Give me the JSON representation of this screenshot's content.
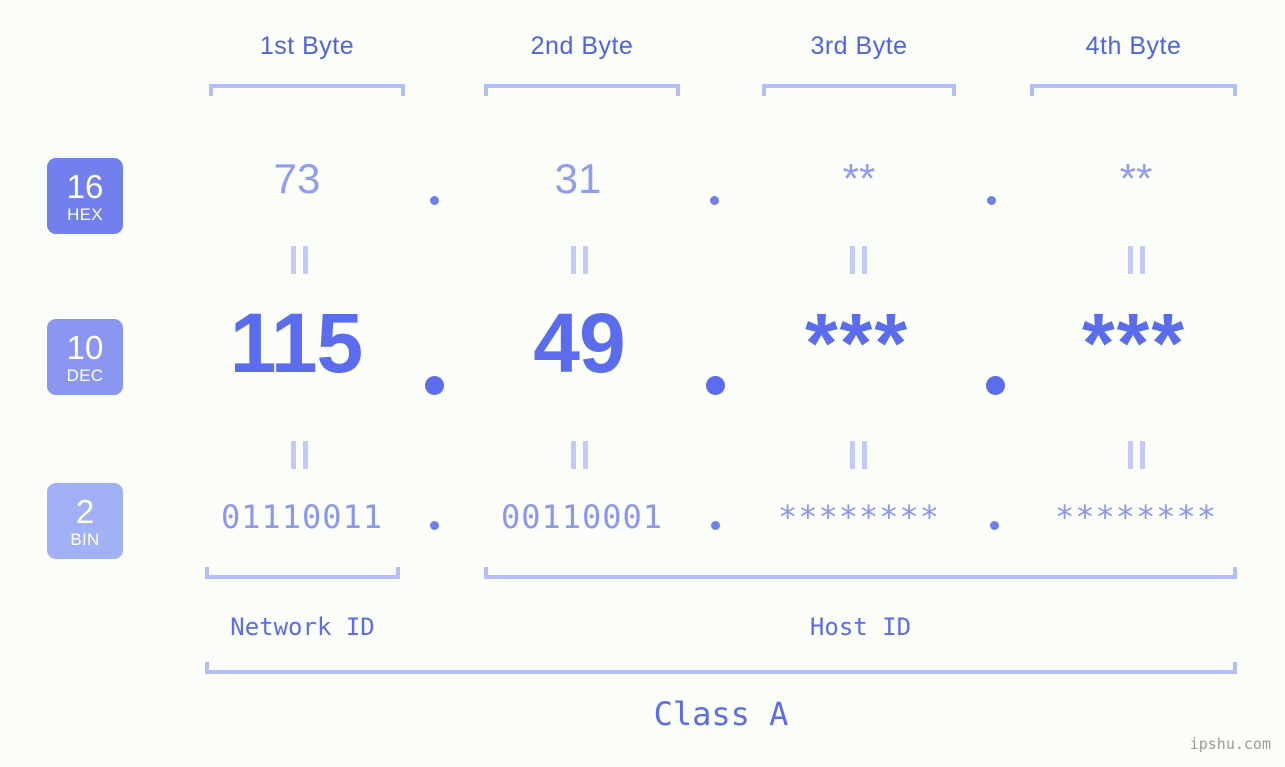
{
  "headers": [
    {
      "label": "1st Byte"
    },
    {
      "label": "2nd Byte"
    },
    {
      "label": "3rd Byte"
    },
    {
      "label": "4th Byte"
    }
  ],
  "bases": [
    {
      "num": "16",
      "abbr": "HEX",
      "color": "#7180ec"
    },
    {
      "num": "10",
      "abbr": "DEC",
      "color": "#8b96f0"
    },
    {
      "num": "2",
      "abbr": "BIN",
      "color": "#a2b0f5"
    }
  ],
  "rows": {
    "hex": {
      "values": [
        "73",
        "31",
        "**",
        "**"
      ]
    },
    "dec": {
      "values": [
        "115",
        "49",
        "***",
        "***"
      ]
    },
    "bin": {
      "values": [
        "01110011",
        "00110001",
        "********",
        "********"
      ]
    }
  },
  "separator": ".",
  "equals_mark": "||",
  "segments": {
    "network_id": "Network ID",
    "host_id": "Host ID",
    "class": "Class A"
  },
  "watermark": "ipshu.com",
  "colors": {
    "background": "#fbfdf8",
    "accent": "#5b6ced",
    "accent_light": "#8b97f1",
    "bracket": "#b3bdf7",
    "eqmark": "#c2cafa",
    "watermark": "#9a9a9a"
  }
}
